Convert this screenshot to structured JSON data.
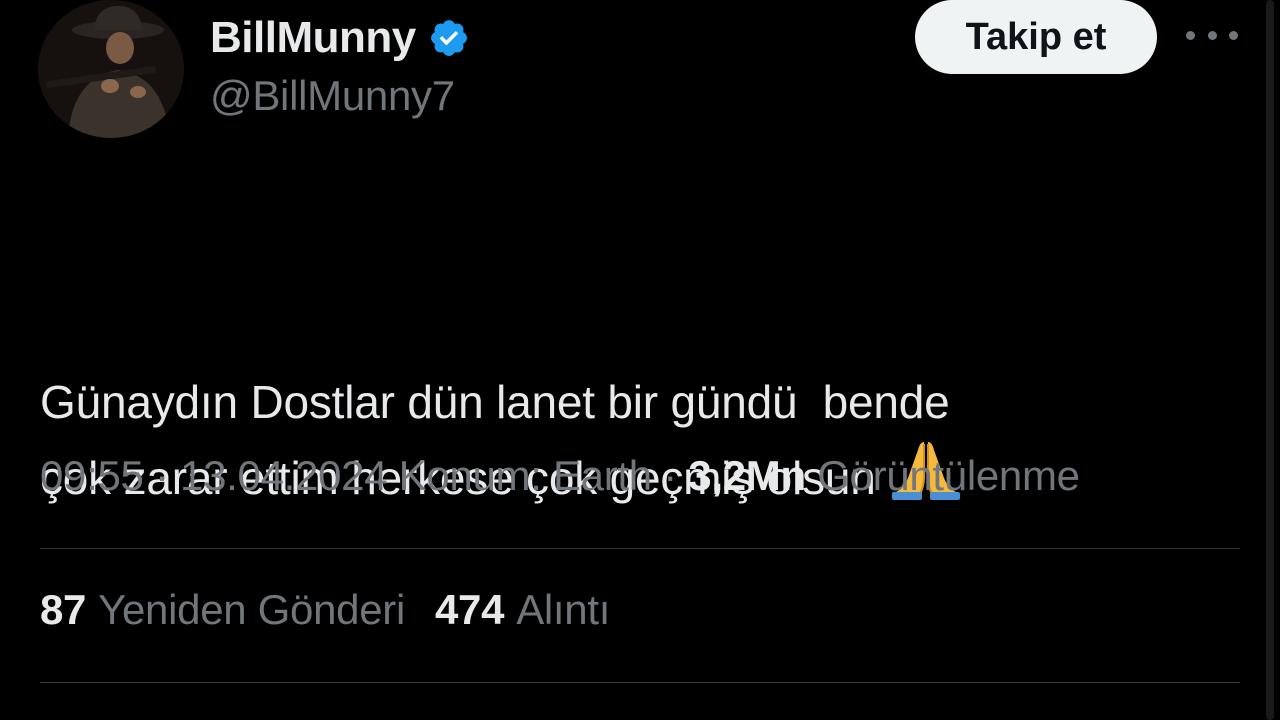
{
  "author": {
    "display_name": "BillMunny",
    "handle": "@BillMunny7",
    "verified": true,
    "verified_color": "#1d9bf0",
    "avatar_icon": "cowboy-avatar"
  },
  "actions": {
    "follow_label": "Takip et",
    "more_icon": "more-dots-icon"
  },
  "tweet": {
    "lines": [
      "Günaydın Dostlar dün lanet bir gündü  bende",
      "çok zarar ettim herkese çok geçmiş olsun"
    ],
    "emoji": "folded-hands"
  },
  "meta": {
    "time": "09:55",
    "separator": " · ",
    "date": "13.04.2024",
    "location": "Konum: Earth",
    "views_count": "3,2Mn",
    "views_label": "Görüntülenme"
  },
  "stats": {
    "reposts_count": "87",
    "reposts_label": "Yeniden Gönderi",
    "quotes_count": "474",
    "quotes_label": "Alıntı"
  },
  "colors": {
    "background": "#000000",
    "primary_text": "#e7e9ea",
    "secondary_text": "#71767b",
    "divider": "#2f3336",
    "follow_button_bg": "#eff3f4"
  }
}
